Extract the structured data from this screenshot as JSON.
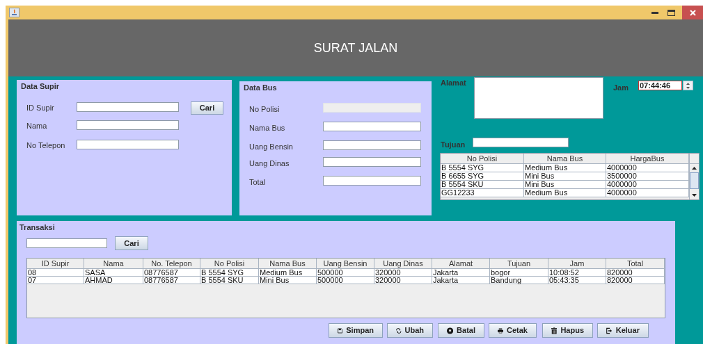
{
  "header": {
    "title": "SURAT JALAN"
  },
  "data_supir": {
    "title": "Data Supir",
    "fields": [
      {
        "label": "ID Supir"
      },
      {
        "label": "Nama"
      },
      {
        "label": "No Telepon"
      }
    ],
    "search_button": "Cari"
  },
  "data_bus": {
    "title": "Data Bus",
    "fields": [
      {
        "label": "No Polisi",
        "disabled": true
      },
      {
        "label": "Nama Bus",
        "disabled": false
      },
      {
        "label": "Uang Bensin",
        "disabled": false
      },
      {
        "label": "Uang Dinas",
        "disabled": false
      },
      {
        "label": "Total",
        "disabled": false
      }
    ]
  },
  "alamat": {
    "label": "Alamat"
  },
  "jam": {
    "label": "Jam",
    "value": "07:44:46"
  },
  "tujuan": {
    "label": "Tujuan"
  },
  "bus_table": {
    "columns": [
      "No Polisi",
      "Nama Bus",
      "HargaBus"
    ],
    "rows": [
      [
        "B 5554 SYG",
        "Medium Bus",
        "4000000"
      ],
      [
        "B 6655 SYG",
        "Mini Bus",
        "3500000"
      ],
      [
        "B 5554 SKU",
        "Mini Bus",
        "4000000"
      ],
      [
        "GG12233",
        "Medium Bus",
        "4000000"
      ]
    ]
  },
  "transaksi": {
    "title": "Transaksi",
    "search_button": "Cari",
    "columns": [
      "ID Supir",
      "Nama",
      "No. Telepon",
      "No Polisi",
      "Nama Bus",
      "Uang Bensin",
      "Uang Dinas",
      "Alamat",
      "Tujuan",
      "Jam",
      "Total"
    ],
    "rows": [
      [
        "08",
        "SASA",
        "08776587",
        "B 5554 SYG",
        "Medium Bus",
        "500000",
        "320000",
        "Jakarta",
        "bogor",
        "10:08:52",
        "820000"
      ],
      [
        "07",
        "AHMAD",
        "08776587",
        "B 5554 SKU",
        "Mini Bus",
        "500000",
        "320000",
        "Jakarta",
        "Bandung",
        "05:43:35",
        "820000"
      ]
    ]
  },
  "buttons": [
    "Simpan",
    "Ubah",
    "Batal",
    "Cetak",
    "Hapus",
    "Keluar"
  ]
}
